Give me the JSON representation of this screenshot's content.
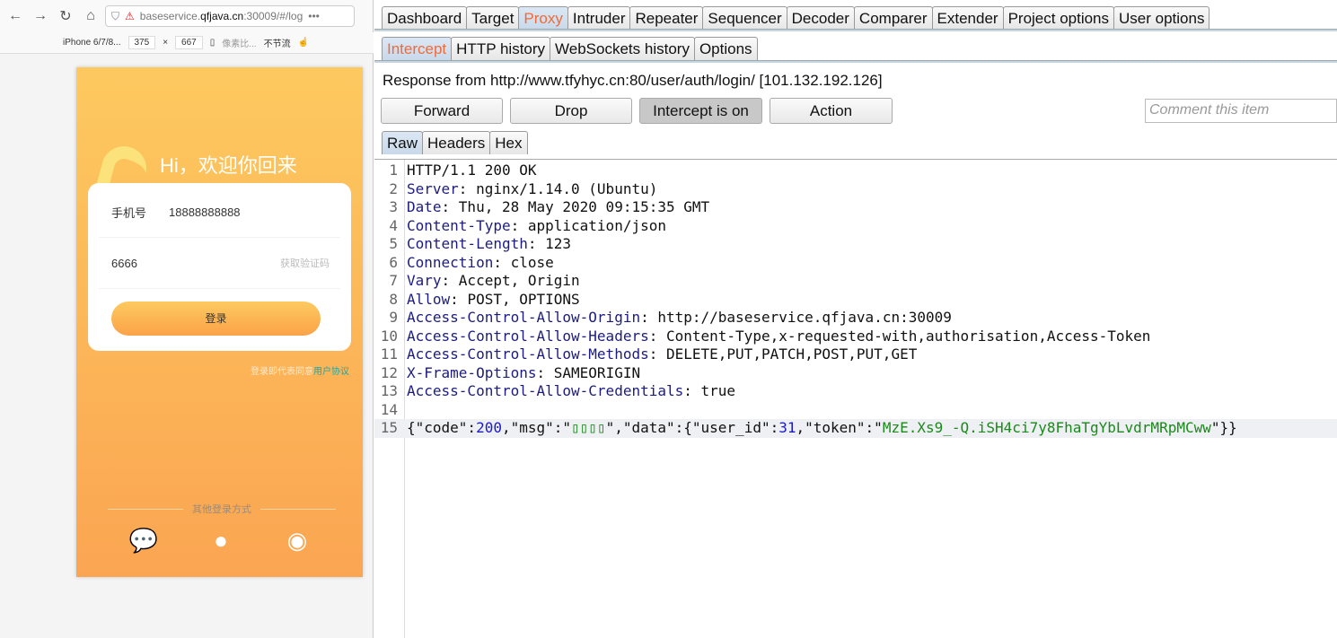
{
  "browser": {
    "url_host": "baseservice.",
    "url_domain": "qfjava.cn",
    "url_rest": ":30009/#/log",
    "device": "iPhone 6/7/8...",
    "width": "375",
    "height": "667",
    "times": "×",
    "dpr": "像素比...",
    "throttle": "不节流"
  },
  "phone": {
    "greeting": "Hi，欢迎你回来",
    "phone_label": "手机号",
    "phone_value": "18888888888",
    "code_value": "6666",
    "get_code": "获取验证码",
    "login": "登录",
    "agree": "登录即代表同意",
    "agreement": "用户协议",
    "other_login": "其他登录方式"
  },
  "burp": {
    "main_tabs": [
      "Dashboard",
      "Target",
      "Proxy",
      "Intruder",
      "Repeater",
      "Sequencer",
      "Decoder",
      "Comparer",
      "Extender",
      "Project options",
      "User options"
    ],
    "active_main": "Proxy",
    "sub_tabs": [
      "Intercept",
      "HTTP history",
      "WebSockets history",
      "Options"
    ],
    "response_from": "Response from http://www.tfyhyc.cn:80/user/auth/login/  [101.132.192.126]",
    "buttons": {
      "forward": "Forward",
      "drop": "Drop",
      "intercept": "Intercept is on",
      "action": "Action"
    },
    "comment_placeholder": "Comment this item",
    "view_tabs": [
      "Raw",
      "Headers",
      "Hex"
    ],
    "status_line": "HTTP/1.1 200 OK",
    "headers": [
      [
        "Server",
        "nginx/1.14.0 (Ubuntu)"
      ],
      [
        "Date",
        "Thu, 28 May 2020 09:15:35 GMT"
      ],
      [
        "Content-Type",
        "application/json"
      ],
      [
        "Content-Length",
        "123"
      ],
      [
        "Connection",
        "close"
      ],
      [
        "Vary",
        "Accept, Origin"
      ],
      [
        "Allow",
        "POST, OPTIONS"
      ],
      [
        "Access-Control-Allow-Origin",
        "http://baseservice.qfjava.cn:30009"
      ],
      [
        "Access-Control-Allow-Headers",
        "Content-Type,x-requested-with,authorisation,Access-Token"
      ],
      [
        "Access-Control-Allow-Methods",
        "DELETE,PUT,PATCH,POST,PUT,GET"
      ],
      [
        "X-Frame-Options",
        "SAMEORIGIN"
      ],
      [
        "Access-Control-Allow-Credentials",
        "true"
      ]
    ],
    "body": {
      "code": "200",
      "msg": "▯▯▯▯",
      "user_id": "31",
      "token": "MzE.Xs9_-Q.iSH4ci7y8FhaTgYbLvdrMRpMCww"
    }
  }
}
